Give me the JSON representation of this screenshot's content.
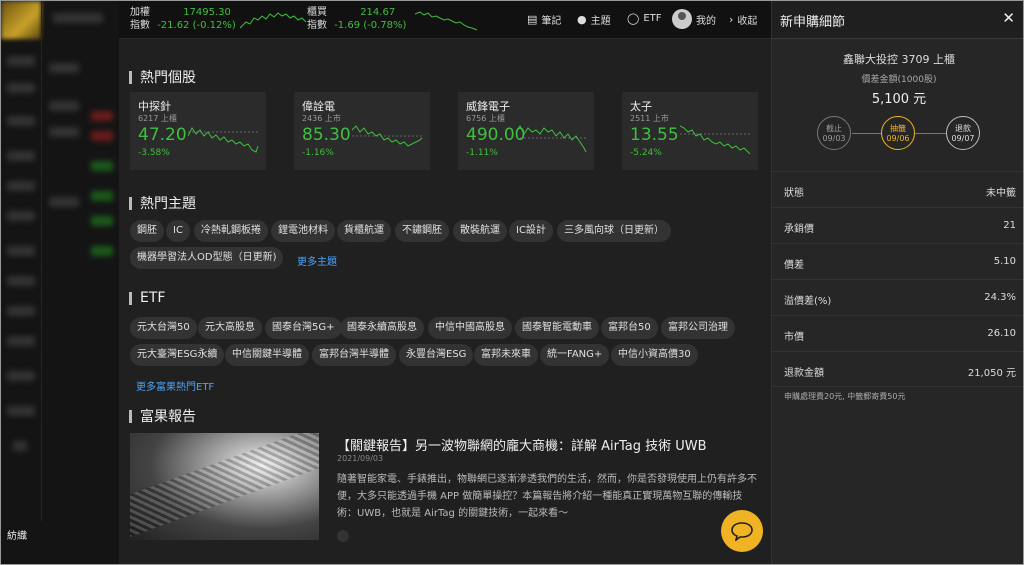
{
  "sidebar": {
    "bottom_tag": "紡織"
  },
  "ticker": {
    "items": [
      {
        "name": "加權",
        "value": "17495.30",
        "label2": "指數",
        "change": "-21.62 (-0.12%)"
      },
      {
        "name": "櫃買",
        "value": "214.67",
        "label2": "指數",
        "change": "-1.69 (-0.78%)"
      }
    ],
    "nav": [
      {
        "icon": "notebook-icon",
        "label": "筆記"
      },
      {
        "icon": "flame-icon",
        "label": "主題"
      },
      {
        "icon": "globe-icon",
        "label": "ETF"
      },
      {
        "icon": "avatar",
        "label": "我的"
      },
      {
        "icon": "chevron-right-icon",
        "label": "收起"
      }
    ]
  },
  "hot_stocks": {
    "title": "熱門個股",
    "cards": [
      {
        "name": "中探針",
        "code": "6217 上櫃",
        "price": "47.20",
        "change": "-3.58%"
      },
      {
        "name": "偉詮電",
        "code": "2436 上市",
        "price": "85.30",
        "change": "-1.16%"
      },
      {
        "name": "威鋒電子",
        "code": "6756 上櫃",
        "price": "490.00",
        "change": "-1.11%"
      },
      {
        "name": "太子",
        "code": "2511 上市",
        "price": "13.55",
        "change": "-5.24%"
      }
    ]
  },
  "hot_topics": {
    "title": "熱門主題",
    "chips": [
      "鋼胚",
      "IC",
      "冷熱軋鋼板捲",
      "鋰電池材料",
      "貨櫃航運",
      "不鏽鋼胚",
      "散裝航運",
      "IC設計",
      "三多風向球（日更新）",
      "機器學習法人OD型態（日更新)"
    ],
    "more": "更多主題"
  },
  "etf": {
    "title": "ETF",
    "chips": [
      "元大台灣50",
      "元大高股息",
      "國泰台灣5G+",
      "國泰永續高股息",
      "中信中國高股息",
      "國泰智能電動車",
      "富邦台50",
      "富邦公司治理",
      "元大臺灣ESG永續",
      "中信關鍵半導體",
      "富邦台灣半導體",
      "永豐台灣ESG",
      "富邦未來車",
      "統一FANG+",
      "中信小資高價30"
    ],
    "more": "更多富果熱門ETF"
  },
  "reports": {
    "title": "富果報告",
    "item": {
      "title": "【關鍵報告】另一波物聯網的龐大商機：詳解 AirTag 技術 UWB",
      "date": "2021/09/03",
      "body": "隨著智能家電、手錶推出，物聯網已逐漸滲透我們的生活，然而，你是否發現使用上仍有許多不便，大多只能透過手機 APP 做簡單操控？本篇報告將介紹一種能真正實現萬物互聯的傳輸技術：UWB，也就是 AirTag 的關鍵技術，一起來看～"
    }
  },
  "panel": {
    "title": "新申購細節",
    "stock": "鑫聯大投控 3709 上櫃",
    "diff_label": "價差金額(1000股)",
    "diff_value": "5,100 元",
    "steps": [
      {
        "label": "截止",
        "date": "09/03"
      },
      {
        "label": "抽籤",
        "date": "09/06"
      },
      {
        "label": "退款",
        "date": "09/07"
      }
    ],
    "rows": [
      {
        "k": "狀態",
        "v": "未中籤"
      },
      {
        "k": "承銷價",
        "v": "21"
      },
      {
        "k": "價差",
        "v": "5.10"
      },
      {
        "k": "溢價差(%)",
        "v": "24.3%"
      },
      {
        "k": "市價",
        "v": "26.10"
      },
      {
        "k": "退款金額",
        "v": "21,050 元"
      }
    ],
    "note": "申購處理費20元, 中籤郵寄費50元"
  },
  "colors": {
    "down": "#3fbf3f",
    "accent": "#f0b323",
    "link": "#4aa3ff"
  }
}
